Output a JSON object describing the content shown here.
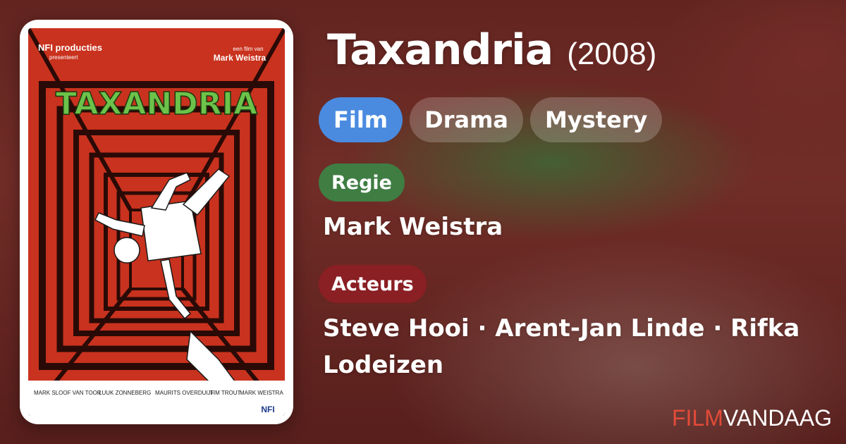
{
  "movie": {
    "title": "Taxandria",
    "year": "(2008)"
  },
  "genres": [
    "Film",
    "Drama",
    "Mystery"
  ],
  "director": {
    "label": "Regie",
    "name": "Mark Weistra"
  },
  "cast": {
    "label": "Acteurs",
    "line1": "Steve Hooi · Arent-Jan Linde · Rifka",
    "line2": "Lodeizen"
  },
  "poster": {
    "top_left": "NFI producties",
    "top_left_sub": "presenteert",
    "top_right_sub": "een film van",
    "top_right": "Mark Weistra",
    "title": "TAXANDRIA",
    "credits_row1": [
      "MARK SLOOF VAN TOOR",
      "LUUK ZONNEBERG",
      "MAURITS OVERDUIJF",
      "TIM TROUT",
      "MARK WEISTRA"
    ],
    "logo": "NFI"
  },
  "brand": {
    "part1": "FILM",
    "part2": "VANDAAG"
  },
  "colors": {
    "genre_primary": "#4a8be0",
    "regie_badge": "#3f7d43",
    "acteurs_badge": "#8a1f24",
    "brand_red": "#e24b38"
  }
}
